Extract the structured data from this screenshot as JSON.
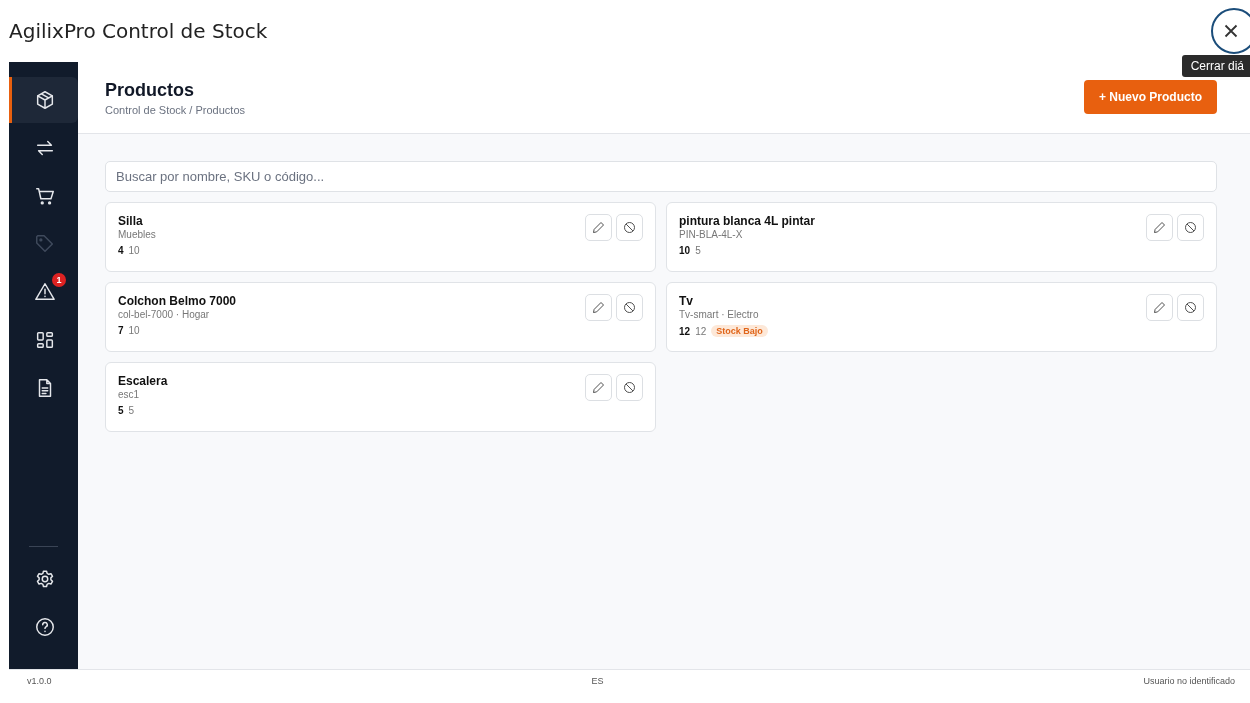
{
  "window": {
    "title": "AgilixPro Control de Stock",
    "tooltip": "Cerrar diá"
  },
  "sidebar": {
    "items": [
      {
        "kind": "box",
        "selected": true,
        "disabled": false
      },
      {
        "kind": "swap",
        "selected": false,
        "disabled": false
      },
      {
        "kind": "cart",
        "selected": false,
        "disabled": false
      },
      {
        "kind": "tag",
        "selected": false,
        "disabled": true
      },
      {
        "kind": "alert",
        "selected": false,
        "disabled": false,
        "badge": "1"
      },
      {
        "kind": "grid",
        "selected": false,
        "disabled": false
      },
      {
        "kind": "file",
        "selected": false,
        "disabled": false
      }
    ],
    "bottom_items": [
      {
        "kind": "gear"
      },
      {
        "kind": "help"
      }
    ]
  },
  "header": {
    "title": "Productos",
    "breadcrumb": "Control de Stock / Productos",
    "new_button": "+ Nuevo Producto"
  },
  "search": {
    "placeholder": "Buscar por nombre, SKU o código..."
  },
  "products": [
    {
      "name": "Silla",
      "meta": "Muebles",
      "stock": "4",
      "minimum": "10"
    },
    {
      "name": "pintura blanca 4L pintar",
      "meta": "PIN-BLA-4L-X",
      "stock": "10",
      "minimum": "5"
    },
    {
      "name": "Colchon Belmo 7000",
      "meta": "col-bel-7000 · Hogar",
      "stock": "7",
      "minimum": "10"
    },
    {
      "name": "Tv",
      "meta": "Tv-smart · Electro",
      "stock": "12",
      "minimum": "12",
      "badge": "Stock Bajo"
    },
    {
      "name": "Escalera",
      "meta": "esc1",
      "stock": "5",
      "minimum": "5"
    }
  ],
  "status_bar": {
    "version": "v1.0.0",
    "language": "ES",
    "user": "Usuario no identificado"
  }
}
